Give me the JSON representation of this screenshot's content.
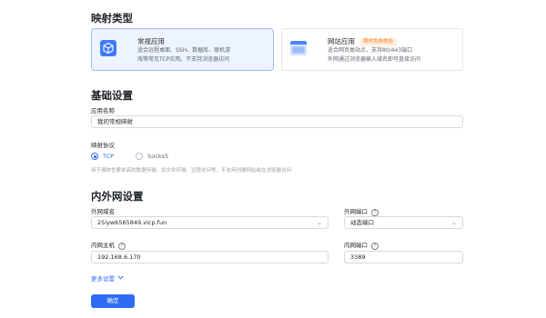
{
  "mapping_type": {
    "title": "映射类型",
    "options": [
      {
        "title": "常规应用",
        "desc_line1": "适合远程桌面、SSH、数据库、联机游",
        "desc_line2": "戏等常见TCP应用。不支持浏览器访问",
        "icon": "cube-icon",
        "selected": true
      },
      {
        "title": "网站应用",
        "badge": "限时免费体验",
        "desc_line1": "适合网页类站点，支持80/443端口",
        "desc_line2": "外网通过浏览器输入域名即可直接访问",
        "icon": "browser-window-icon",
        "selected": false
      }
    ]
  },
  "basic": {
    "title": "基础设置",
    "app_name_label": "应用名称",
    "app_name_value": "我的常规映射",
    "protocol_label": "映射协议",
    "protocol_options": [
      "TCP",
      "Socks5"
    ],
    "protocol_selected": "TCP",
    "protocol_hint": "用于满体性要求高的数据传输，如文件传输、远程访问等，不支持创建网站或在浏览器访问"
  },
  "network": {
    "title": "内外网设置",
    "ext_domain_label": "外网域名",
    "ext_domain_value": "25iywb565849.vicp.fun",
    "ext_port_label": "外网端口",
    "ext_port_value": "动态端口",
    "int_host_label": "内网主机",
    "int_host_value": "192.168.6.170",
    "int_port_label": "内网端口",
    "int_port_value": "3389",
    "help_glyph": "?"
  },
  "more_settings": "更多设置",
  "confirm": "确定",
  "colors": {
    "accent": "#2f6bf5",
    "selected_bg": "#eef4ff",
    "badge": "#ff7a1a"
  }
}
